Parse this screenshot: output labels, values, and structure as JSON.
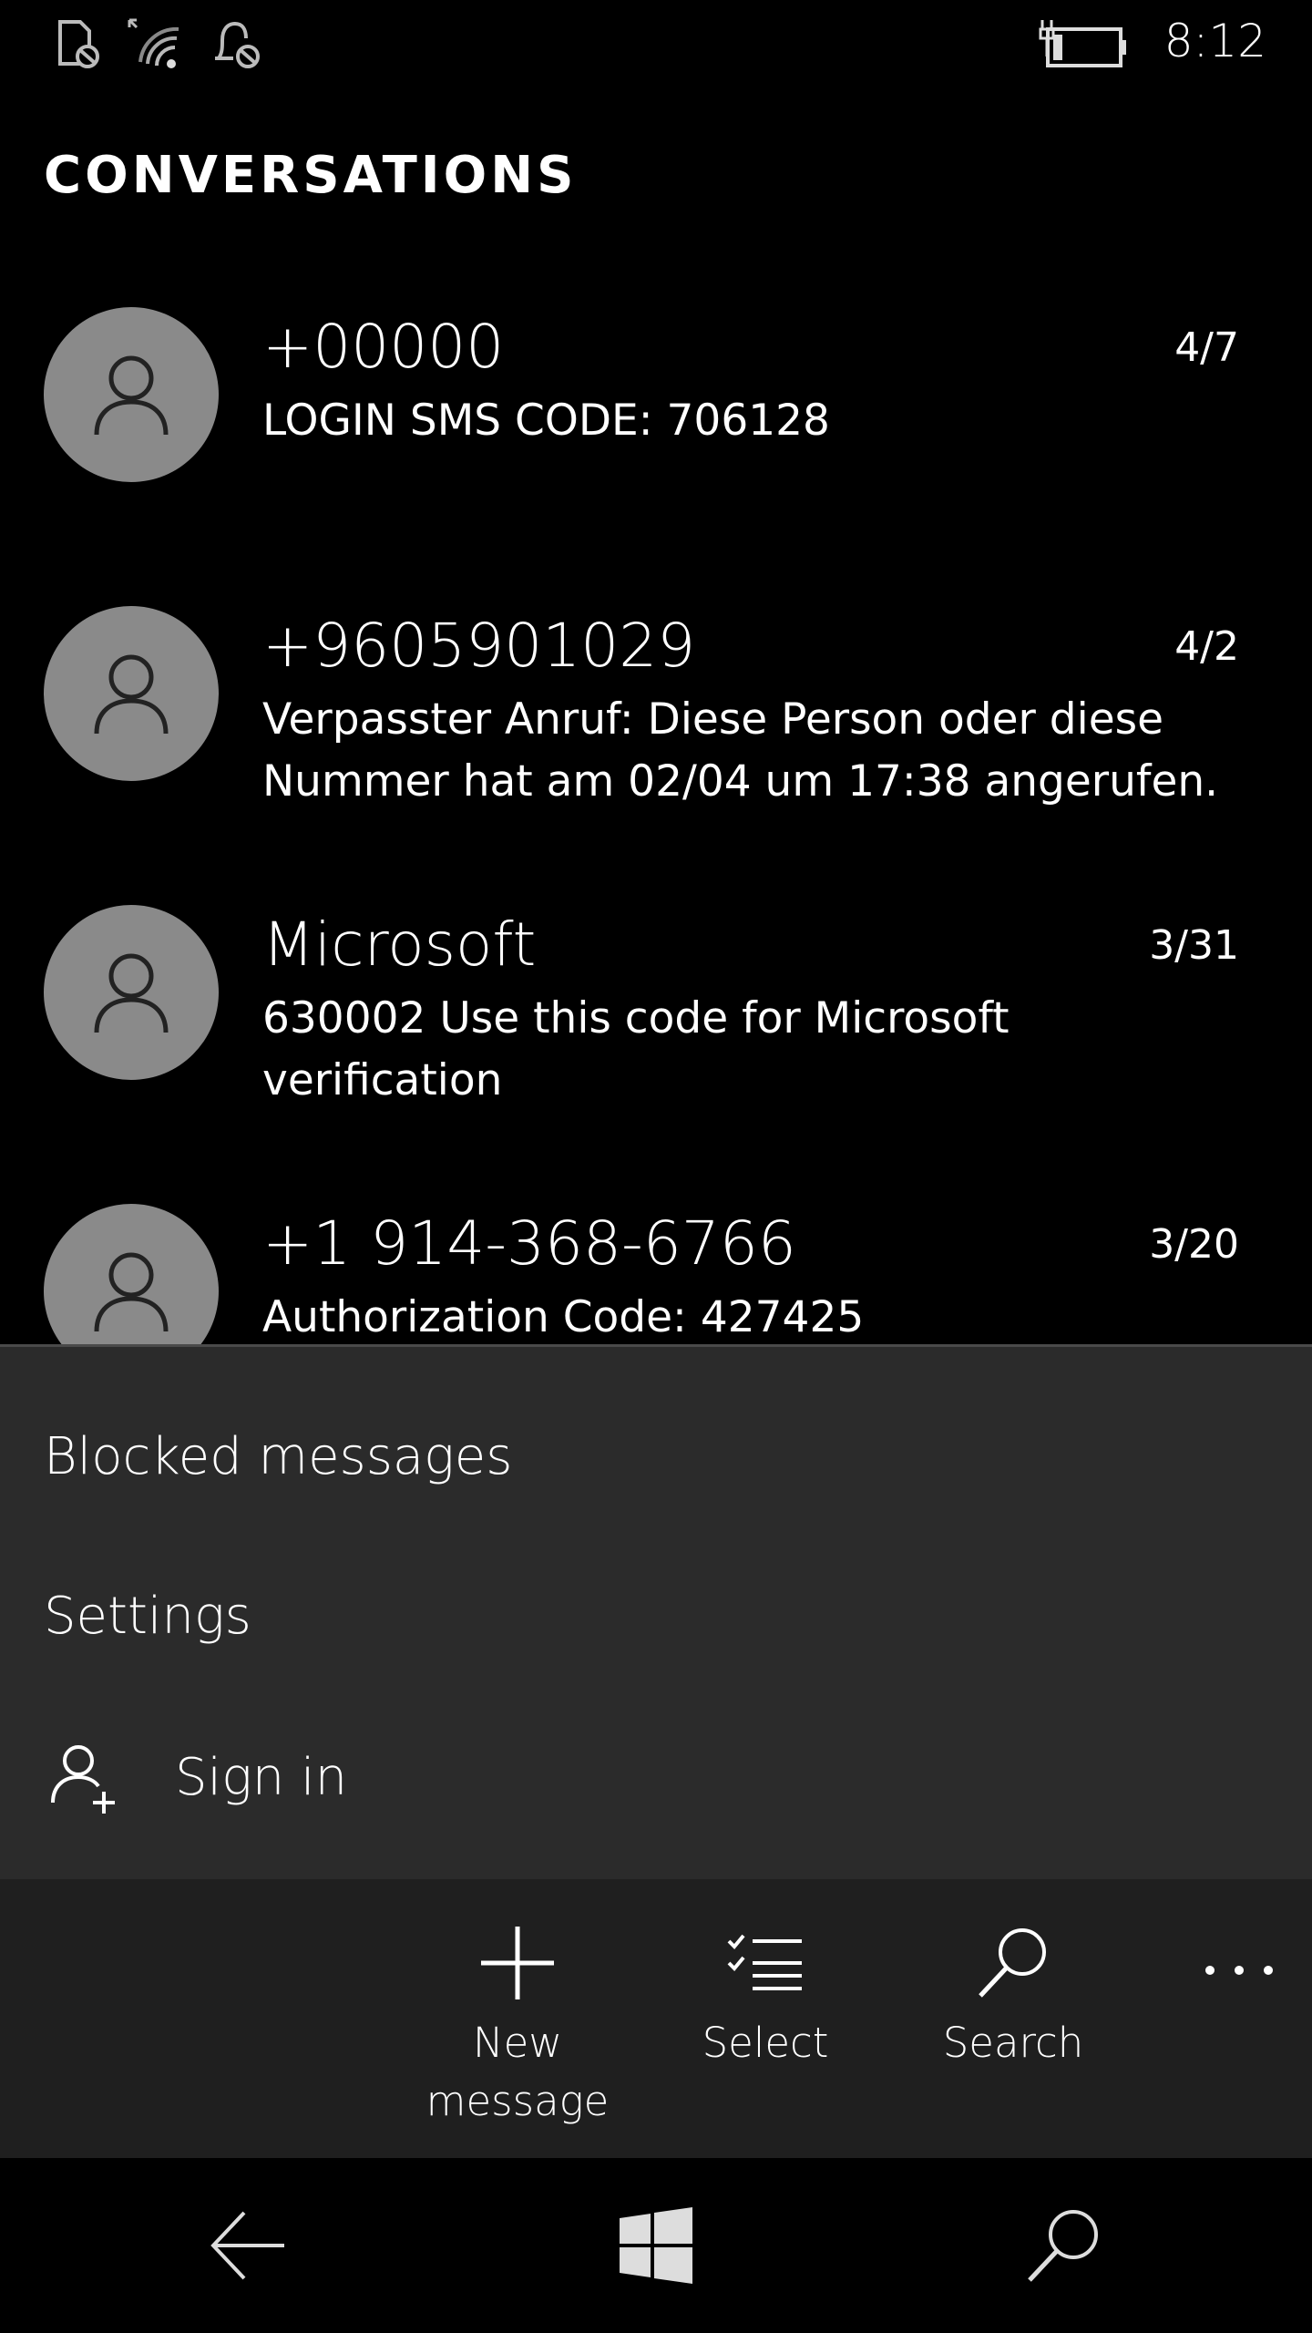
{
  "status_bar": {
    "time": "8:12",
    "icons": [
      "sim-no-service-icon",
      "wifi-weak-icon",
      "quiet-hours-icon",
      "battery-charging-icon"
    ]
  },
  "header": {
    "title": "CONVERSATIONS"
  },
  "conversations": [
    {
      "name": "+00000",
      "date": "4/7",
      "preview": "LOGIN SMS CODE: 706128",
      "icon": "person-icon"
    },
    {
      "name": "+9605901029",
      "date": "4/2",
      "preview": "Verpasster Anruf: Diese Person oder diese Nummer hat am 02/04 um 17:38 angerufen.",
      "icon": "person-icon"
    },
    {
      "name": "Microsoft",
      "date": "3/31",
      "preview": "630002 Use this code for Microsoft verification",
      "icon": "person-icon"
    },
    {
      "name": "+1 914-368-6766",
      "date": "3/20",
      "preview": "Authorization Code: 427425",
      "icon": "person-icon"
    }
  ],
  "menu": {
    "items": [
      {
        "label": "Blocked messages"
      },
      {
        "label": "Settings"
      },
      {
        "label": "Sign in",
        "icon": "add-person-icon"
      }
    ]
  },
  "app_bar": {
    "new_message_line1": "New",
    "new_message_line2": "message",
    "select": "Select",
    "search": "Search",
    "more_icon": "more-dots-icon"
  },
  "nav_bar": {
    "icons": [
      "back-arrow-icon",
      "windows-logo-icon",
      "search-icon"
    ]
  },
  "colors": {
    "background": "#000000",
    "menu": "#2b2b2b",
    "app_bar": "#1f1f1f",
    "avatar": "#8a8a8a"
  }
}
